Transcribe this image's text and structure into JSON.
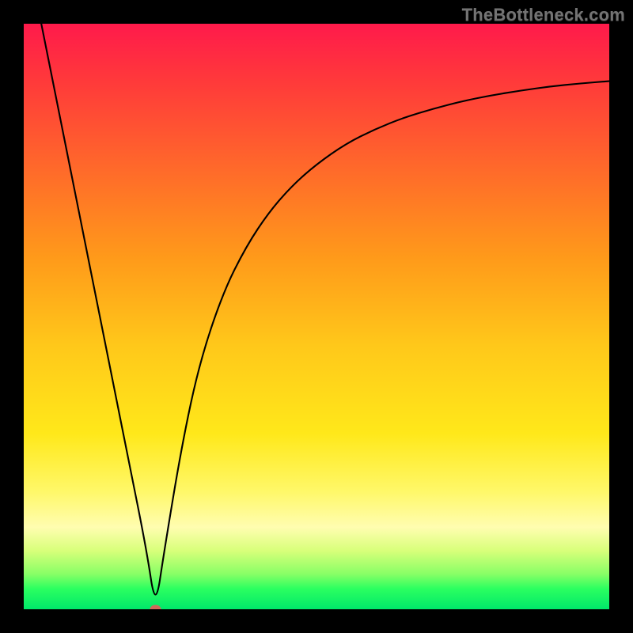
{
  "watermark": "TheBottleneck.com",
  "chart_data": {
    "type": "line",
    "title": "",
    "xlabel": "",
    "ylabel": "",
    "xlim": [
      0,
      100
    ],
    "ylim": [
      0,
      100
    ],
    "grid": false,
    "legend": false,
    "series": [
      {
        "name": "curve",
        "x": [
          3,
          6,
          9,
          12,
          15,
          18,
          21,
          22.5,
          24,
          27,
          30,
          34,
          38,
          42,
          46,
          50,
          55,
          60,
          65,
          70,
          75,
          80,
          85,
          90,
          95,
          100
        ],
        "y": [
          100,
          85,
          70,
          55,
          40,
          25,
          10,
          0,
          10,
          28,
          42,
          54,
          62,
          68,
          72.5,
          76,
          79.5,
          82,
          84,
          85.5,
          86.8,
          87.8,
          88.6,
          89.3,
          89.8,
          90.2
        ]
      }
    ],
    "marker": {
      "x": 22.5,
      "y": 0,
      "color": "#d06a5a"
    }
  }
}
